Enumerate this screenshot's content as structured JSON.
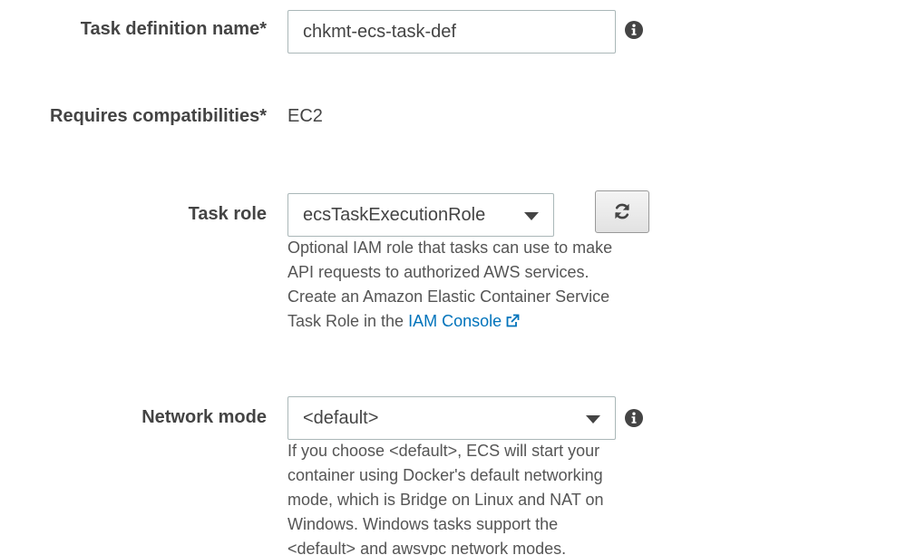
{
  "task_definition_name": {
    "label": "Task definition name*",
    "value": "chkmt-ecs-task-def"
  },
  "requires_compatibilities": {
    "label": "Requires compatibilities*",
    "value": "EC2"
  },
  "task_role": {
    "label": "Task role",
    "selected": "ecsTaskExecutionRole",
    "help_lines": [
      "Optional IAM role that tasks can use to make",
      "API requests to authorized AWS services.",
      "Create an Amazon Elastic Container Service"
    ],
    "help_last_prefix": "Task Role in the",
    "help_link": "IAM Console"
  },
  "network_mode": {
    "label": "Network mode",
    "selected": "<default>",
    "help_lines": [
      "If you choose <default>, ECS will start your",
      "container using Docker's default networking",
      "mode, which is Bridge on Linux and NAT on",
      "Windows. Windows tasks support the",
      "<default> and awsvpc network modes."
    ]
  },
  "icons": {
    "info": "info-icon",
    "refresh": "refresh-icon",
    "external_link": "external-link-icon",
    "caret": "caret-down-icon"
  },
  "colors": {
    "text": "#444444",
    "link": "#0073bb",
    "border": "#aab7b8"
  }
}
